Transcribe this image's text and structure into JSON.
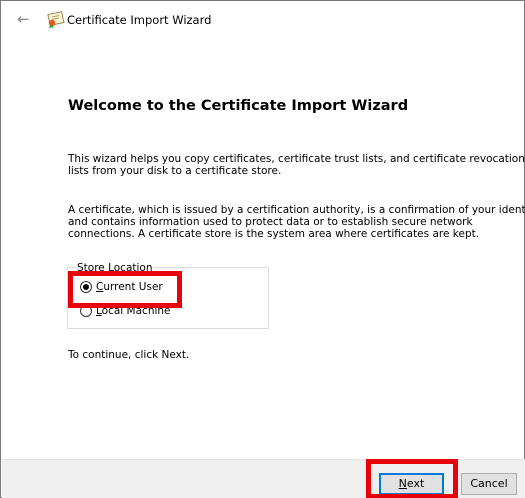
{
  "window": {
    "title": "Certificate Import Wizard",
    "back_glyph": "←"
  },
  "main": {
    "heading": "Welcome to the Certificate Import Wizard",
    "paragraph1_line1": "This wizard helps you copy certificates, certificate trust lists, and certificate revocation",
    "paragraph1_line2": "lists from your disk to a certificate store.",
    "paragraph2_line1": "A certificate, which is issued by a certification authority, is a confirmation of your identity",
    "paragraph2_line2": "and contains information used to protect data or to establish secure network",
    "paragraph2_line3": "connections. A certificate store is the system area where certificates are kept.",
    "store_location": {
      "label": "Store Location",
      "options": [
        {
          "first": "C",
          "rest": "urrent User",
          "selected": true
        },
        {
          "first": "L",
          "rest": "ocal Machine",
          "selected": false
        }
      ]
    },
    "continue_text": "To continue, click Next."
  },
  "footer": {
    "next_first": "N",
    "next_rest": "ext",
    "cancel_label": "Cancel"
  },
  "colors": {
    "highlight": "#e8000b",
    "default_button_border": "#0078d7",
    "footer_bg": "#f0f0f0"
  },
  "icons": [
    "back-arrow-icon",
    "certificate-icon"
  ]
}
